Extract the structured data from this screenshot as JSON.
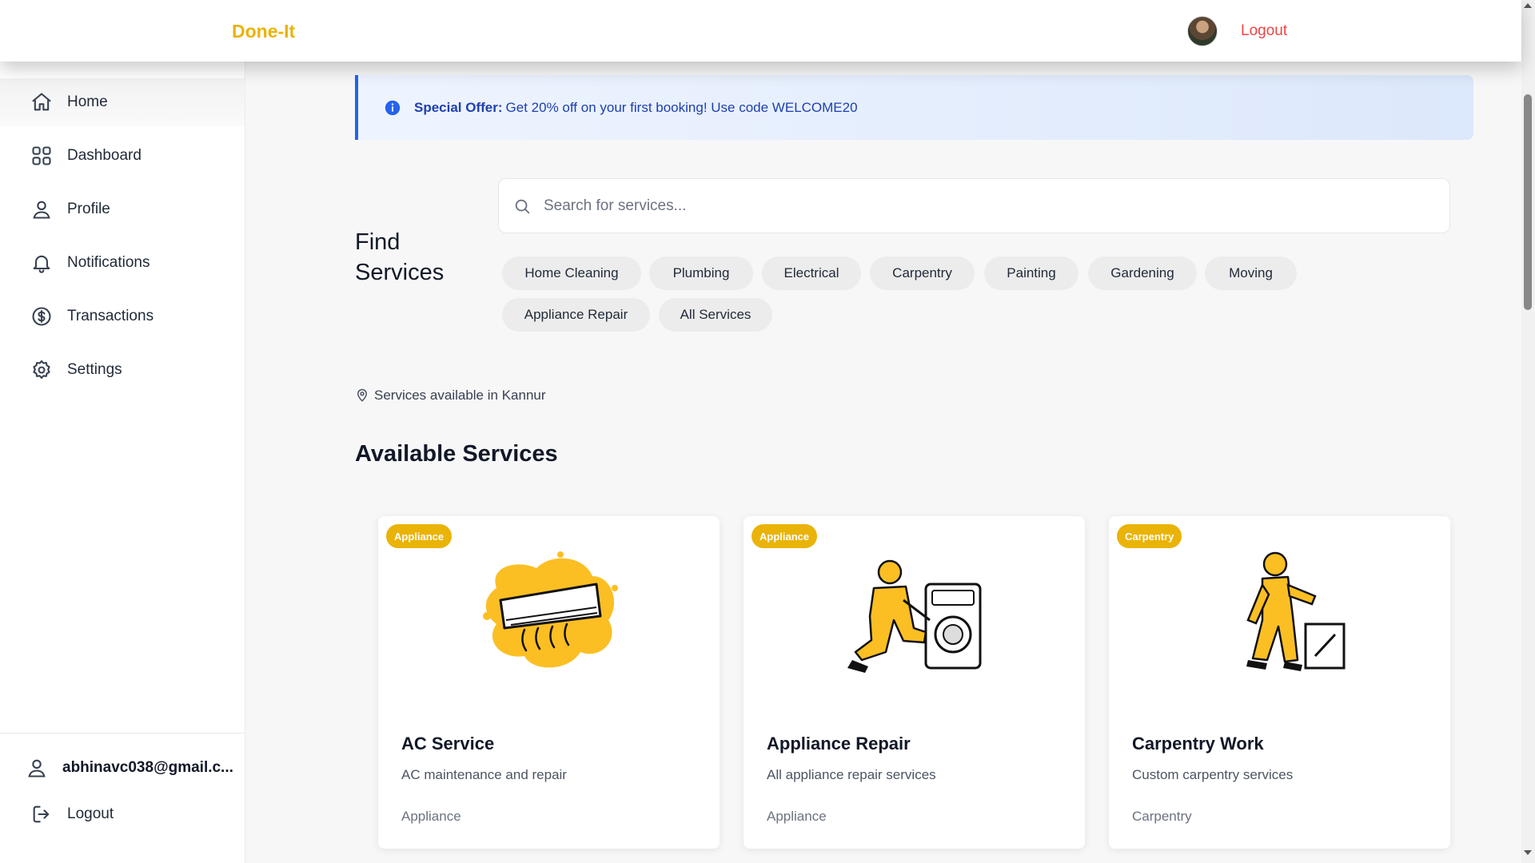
{
  "header": {
    "brand": "Done-It",
    "avatar_icon": "user-avatar",
    "logout_label": "Logout"
  },
  "sidebar": {
    "items": [
      {
        "label": "Home",
        "icon": "home-icon",
        "active": true
      },
      {
        "label": "Dashboard",
        "icon": "grid-icon",
        "active": false
      },
      {
        "label": "Profile",
        "icon": "user-icon",
        "active": false
      },
      {
        "label": "Notifications",
        "icon": "bell-icon",
        "active": false
      },
      {
        "label": "Transactions",
        "icon": "dollar-icon",
        "active": false
      },
      {
        "label": "Settings",
        "icon": "gear-icon",
        "active": false
      }
    ],
    "user_email": "abhinavc038@gmail.c...",
    "logout_label": "Logout"
  },
  "offer": {
    "strong": "Special Offer:",
    "text": "Get 20% off on your first booking! Use code WELCOME20",
    "color": "#2563eb"
  },
  "find": {
    "title": "Find Services",
    "search_placeholder": "Search for services...",
    "categories": [
      "Home Cleaning",
      "Plumbing",
      "Electrical",
      "Carpentry",
      "Painting",
      "Gardening",
      "Moving",
      "Appliance Repair",
      "All Services"
    ]
  },
  "location": {
    "text": "Services available in Kannur"
  },
  "services": {
    "title": "Available Services",
    "cards": [
      {
        "badge": "Appliance",
        "title": "AC Service",
        "description": "AC maintenance and repair",
        "category": "Appliance",
        "image": "ac-unit-illustration"
      },
      {
        "badge": "Appliance",
        "title": "Appliance Repair",
        "description": "All appliance repair services",
        "category": "Appliance",
        "image": "technician-washing-machine-illustration"
      },
      {
        "badge": "Carpentry",
        "title": "Carpentry Work",
        "description": "Custom carpentry services",
        "category": "Carpentry",
        "image": "carpenter-worker-illustration"
      }
    ]
  },
  "theme": {
    "accent": "#eab308",
    "logout": "#ef4444",
    "offer_text": "#1e40af"
  }
}
